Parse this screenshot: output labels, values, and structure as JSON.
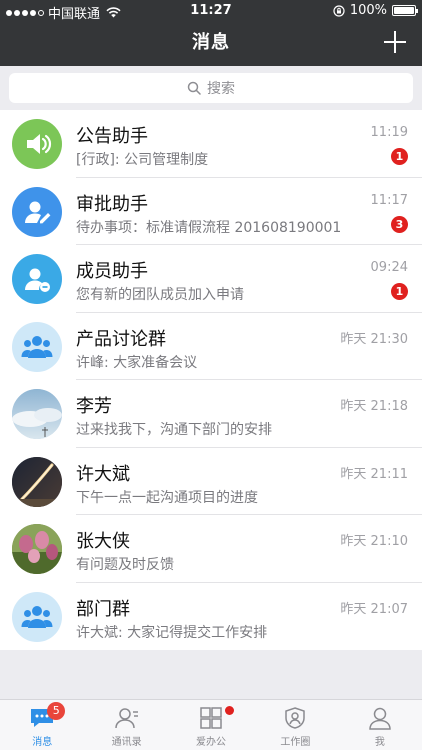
{
  "status_bar": {
    "carrier": "中国联通",
    "time": "11:27",
    "battery": "100%",
    "battery_level": 1.0
  },
  "header": {
    "title": "消息",
    "add_icon": "plus-icon"
  },
  "search": {
    "placeholder": "搜索",
    "icon": "search-icon"
  },
  "conversations": [
    {
      "name": "公告助手",
      "preview": "[行政]: 公司管理制度",
      "time": "11:19",
      "badge": "1",
      "avatar": "speaker-icon",
      "avatar_color": "#7cc657"
    },
    {
      "name": "审批助手",
      "preview": "待办事项：标准请假流程 201608190001",
      "time": "11:17",
      "badge": "3",
      "avatar": "approval-user-icon",
      "avatar_color": "#3f93ea"
    },
    {
      "name": "成员助手",
      "preview": "您有新的团队成员加入申请",
      "time": "09:24",
      "badge": "1",
      "avatar": "member-user-icon",
      "avatar_color": "#3aa9e6"
    },
    {
      "name": "产品讨论群",
      "preview": "许峰: 大家准备会议",
      "time": "昨天 21:30",
      "badge": "",
      "avatar": "group-icon",
      "avatar_color": "#cfe8f8"
    },
    {
      "name": "李芳",
      "preview": "过来找我下，沟通下部门的安排",
      "time": "昨天 21:18",
      "badge": "",
      "avatar": "sky-photo-avatar",
      "avatar_color": "#b9d2e6"
    },
    {
      "name": "许大斌",
      "preview": "下午一点一起沟通项目的进度",
      "time": "昨天 21:11",
      "badge": "",
      "avatar": "rocket-photo-avatar",
      "avatar_color": "#3b3e4a"
    },
    {
      "name": "张大侠",
      "preview": "有问题及时反馈",
      "time": "昨天 21:10",
      "badge": "",
      "avatar": "tulip-photo-avatar",
      "avatar_color": "#6f8a4a"
    },
    {
      "name": "部门群",
      "preview": "许大斌: 大家记得提交工作安排",
      "time": "昨天 21:07",
      "badge": "",
      "avatar": "group-icon",
      "avatar_color": "#cfe8f8"
    }
  ],
  "tabs": [
    {
      "label": "消息",
      "icon": "chat-icon",
      "active": true,
      "badge": "5"
    },
    {
      "label": "通讯录",
      "icon": "contacts-icon",
      "active": false,
      "badge": ""
    },
    {
      "label": "爱办公",
      "icon": "grid-icon",
      "active": false,
      "badge": "",
      "dot": true
    },
    {
      "label": "工作圈",
      "icon": "work-circle-icon",
      "active": false,
      "badge": ""
    },
    {
      "label": "我",
      "icon": "profile-icon",
      "active": false,
      "badge": ""
    }
  ],
  "colors": {
    "header_bg": "#343638",
    "accent": "#2f8fe6",
    "badge_red": "#e0211f"
  }
}
